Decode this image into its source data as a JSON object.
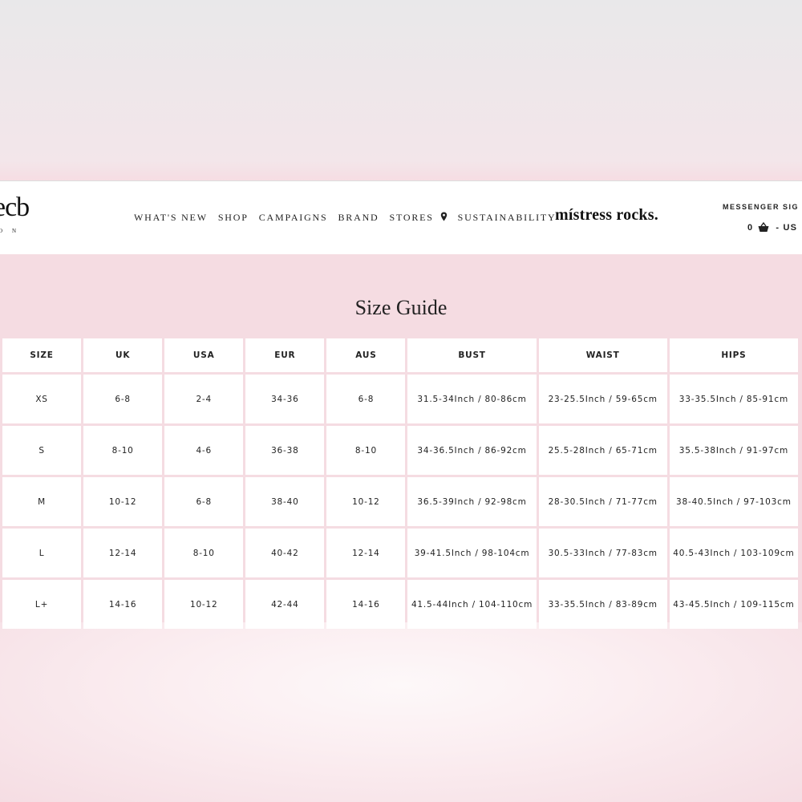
{
  "header": {
    "logo": "ecb",
    "logo_sub": "ON",
    "nav": [
      "WHAT'S NEW",
      "SHOP",
      "CAMPAIGNS",
      "BRAND",
      "STORES",
      "SUSTAINABILITY"
    ],
    "brand_tagline": "místress rocks.",
    "messenger": "MESSENGER  SIG",
    "cart_count": "0",
    "currency": "-  US"
  },
  "main": {
    "title": "Size Guide"
  },
  "table": {
    "headers": [
      "SIZE",
      "UK",
      "USA",
      "EUR",
      "AUS",
      "BUST",
      "WAIST",
      "HIPS"
    ],
    "rows": [
      [
        "XS",
        "6-8",
        "2-4",
        "34-36",
        "6-8",
        "31.5-34Inch / 80-86cm",
        "23-25.5Inch / 59-65cm",
        "33-35.5Inch / 85-91cm"
      ],
      [
        "S",
        "8-10",
        "4-6",
        "36-38",
        "8-10",
        "34-36.5Inch / 86-92cm",
        "25.5-28Inch / 65-71cm",
        "35.5-38Inch / 91-97cm"
      ],
      [
        "M",
        "10-12",
        "6-8",
        "38-40",
        "10-12",
        "36.5-39Inch / 92-98cm",
        "28-30.5Inch / 71-77cm",
        "38-40.5Inch / 97-103cm"
      ],
      [
        "L",
        "12-14",
        "8-10",
        "40-42",
        "12-14",
        "39-41.5Inch / 98-104cm",
        "30.5-33Inch / 77-83cm",
        "40.5-43Inch / 103-109cm"
      ],
      [
        "L+",
        "14-16",
        "10-12",
        "42-44",
        "14-16",
        "41.5-44Inch / 104-110cm",
        "33-35.5Inch / 83-89cm",
        "43-45.5Inch / 109-115cm"
      ]
    ]
  },
  "colors": {
    "page_bg": "#f5dce2",
    "header_bg": "#ffffff",
    "text": "#222222"
  },
  "icons": [
    "location-pin-icon",
    "shopping-basket-icon"
  ]
}
